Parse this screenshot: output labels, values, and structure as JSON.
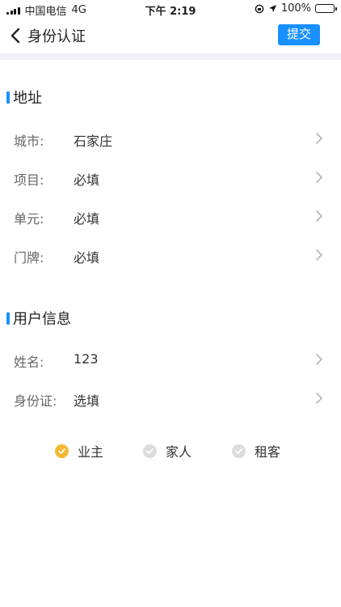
{
  "status_bar": {
    "carrier": "中国电信",
    "network": "4G",
    "time": "下午 2:19",
    "battery": "100%"
  },
  "nav": {
    "title": "身份认证",
    "submit_label": "提交"
  },
  "address": {
    "title": "地址",
    "rows": [
      {
        "label": "城市:",
        "value": "石家庄"
      },
      {
        "label": "项目:",
        "value": "必填"
      },
      {
        "label": "单元:",
        "value": "必填"
      },
      {
        "label": "门牌:",
        "value": "必填"
      }
    ]
  },
  "user": {
    "title": "用户信息",
    "rows": [
      {
        "label": "姓名:",
        "value": "123"
      },
      {
        "label": "身份证:",
        "value": "选填"
      }
    ]
  },
  "roles": [
    {
      "label": "业主",
      "selected": true
    },
    {
      "label": "家人",
      "selected": false
    },
    {
      "label": "租客",
      "selected": false
    }
  ],
  "colors": {
    "accent": "#1890ff",
    "selected": "#f7b731",
    "unselected": "#dcdcdc"
  }
}
